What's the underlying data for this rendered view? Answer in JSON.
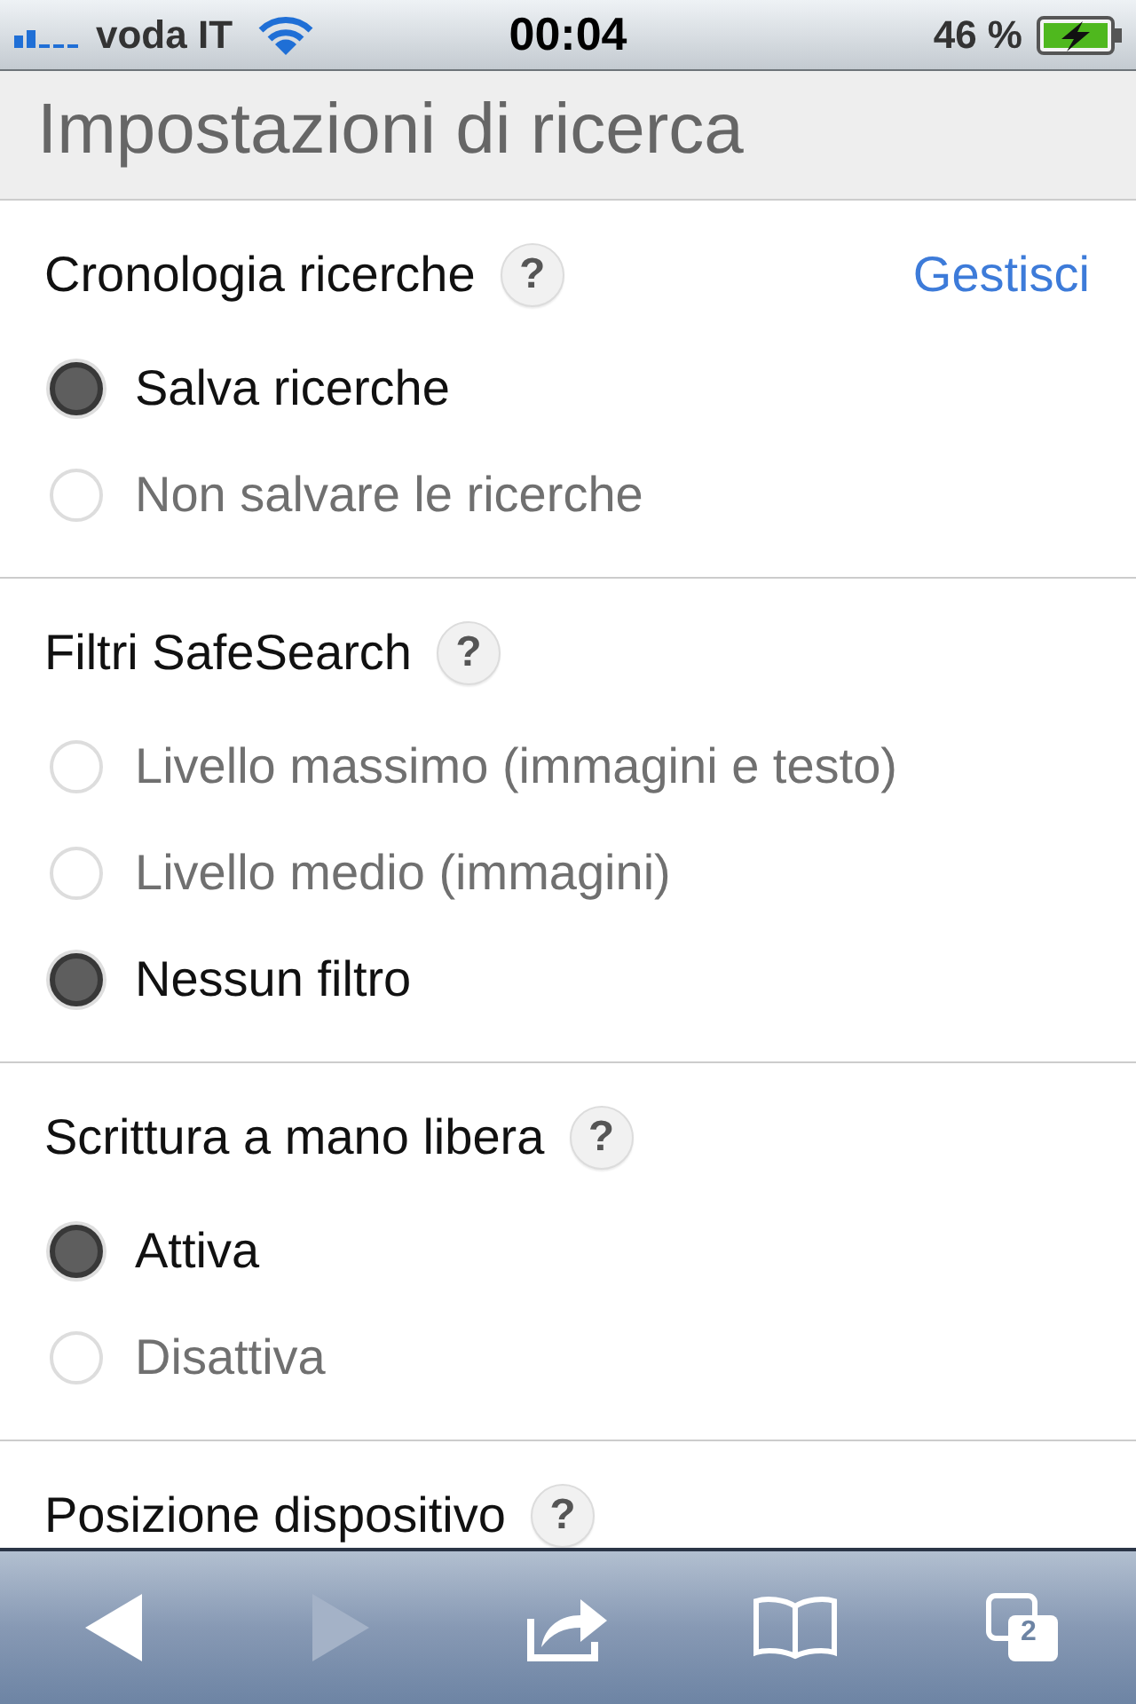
{
  "status_bar": {
    "carrier": "voda IT",
    "time": "00:04",
    "battery": "46 %",
    "charging": true
  },
  "page_title": "Impostazioni di ricerca",
  "sections": [
    {
      "title": "Cronologia ricerche",
      "help": "?",
      "link": "Gestisci",
      "options": [
        {
          "label": "Salva ricerche",
          "selected": true
        },
        {
          "label": "Non salvare le ricerche",
          "selected": false
        }
      ]
    },
    {
      "title": "Filtri SafeSearch",
      "help": "?",
      "options": [
        {
          "label": "Livello massimo (immagini e testo)",
          "selected": false
        },
        {
          "label": "Livello medio (immagini)",
          "selected": false
        },
        {
          "label": "Nessun filtro",
          "selected": true
        }
      ]
    },
    {
      "title": "Scrittura a mano libera",
      "help": "?",
      "options": [
        {
          "label": "Attiva",
          "selected": true
        },
        {
          "label": "Disattiva",
          "selected": false
        }
      ]
    },
    {
      "title": "Posizione dispositivo",
      "help": "?"
    }
  ],
  "toolbar": {
    "buttons": [
      {
        "kind": "back",
        "disabled": false
      },
      {
        "kind": "forward",
        "disabled": true
      },
      {
        "kind": "share",
        "disabled": false
      },
      {
        "kind": "bookmarks",
        "disabled": false
      },
      {
        "kind": "tabs",
        "disabled": false,
        "count": "2"
      }
    ]
  }
}
